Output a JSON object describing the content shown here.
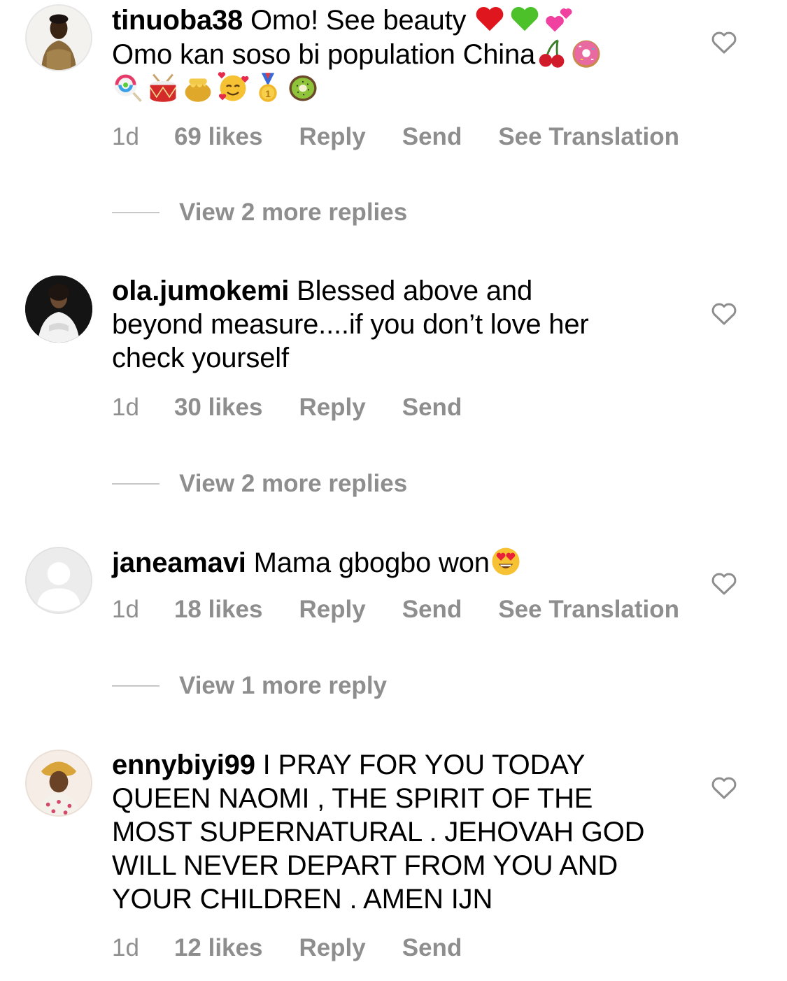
{
  "comments": [
    {
      "username": "tinuoba38",
      "text": " Omo! See beauty",
      "text_line2": "Omo kan soso bi population China",
      "emojis_line1": [
        "red-heart",
        "green-heart",
        "two-hearts"
      ],
      "emojis_line2": [
        "cherries",
        "doughnut"
      ],
      "emojis_line3": [
        "lollipop",
        "drum",
        "honey-pot",
        "smiling-face-with-hearts",
        "first-place-medal",
        "kiwi"
      ],
      "time": "1d",
      "likes": "69 likes",
      "reply": "Reply",
      "send": "Send",
      "translate": "See Translation",
      "view_replies": "View 2 more replies"
    },
    {
      "username": "ola.jumokemi",
      "text": " Blessed above and",
      "text_line2": "beyond measure....if you don’t love her",
      "text_line3": "check yourself",
      "time": "1d",
      "likes": "30 likes",
      "reply": "Reply",
      "send": "Send",
      "view_replies": "View 2 more replies"
    },
    {
      "username": "janeamavi",
      "text": " Mama gbogbo won",
      "emoji": "heart-eyes",
      "time": "1d",
      "likes": "18 likes",
      "reply": "Reply",
      "send": "Send",
      "translate": "See Translation",
      "view_replies": "View 1 more reply"
    },
    {
      "username": "ennybiyi99",
      "text": " I PRAY FOR YOU TODAY",
      "text_line2": "QUEEN NAOMI , THE SPIRIT OF THE",
      "text_line3": "MOST SUPERNATURAL . JEHOVAH GOD",
      "text_line4": "WILL NEVER DEPART FROM YOU AND",
      "text_line5": "YOUR CHILDREN . AMEN IJN",
      "time": "1d",
      "likes": "12 likes",
      "reply": "Reply",
      "send": "Send"
    }
  ]
}
